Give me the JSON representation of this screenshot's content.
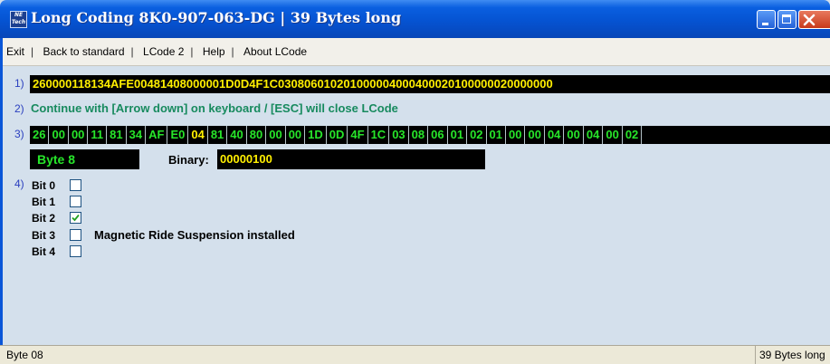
{
  "window": {
    "title": "Long Coding  8K0-907-063-DG | 39 Bytes long",
    "icon": "nf-tech-app-icon"
  },
  "menu": {
    "items": [
      "Exit",
      "Back to standard",
      "LCode 2",
      "Help",
      "About LCode"
    ],
    "separator": "|"
  },
  "rows": {
    "row1_num": "1)",
    "row2_num": "2)",
    "row3_num": "3)",
    "row4_num": "4)"
  },
  "coding_string": "260000118134AFE00481408000001D0D4F1C030806010201000004000400020100000020000000",
  "hint": "Continue with [Arrow down] on keyboard / [ESC] will close LCode",
  "bytes": [
    "26",
    "00",
    "00",
    "11",
    "81",
    "34",
    "AF",
    "E0",
    "04",
    "81",
    "40",
    "80",
    "00",
    "00",
    "1D",
    "0D",
    "4F",
    "1C",
    "03",
    "08",
    "06",
    "01",
    "02",
    "01",
    "00",
    "00",
    "04",
    "00",
    "04",
    "00",
    "02"
  ],
  "selected_byte_index": 8,
  "byte_label": "Byte 8",
  "binary_label": "Binary:",
  "binary_value": "00000100",
  "bits": [
    {
      "label": "Bit 0",
      "checked": false,
      "description": ""
    },
    {
      "label": "Bit 1",
      "checked": false,
      "description": ""
    },
    {
      "label": "Bit 2",
      "checked": true,
      "description": ""
    },
    {
      "label": "Bit 3",
      "checked": false,
      "description": "Magnetic Ride Suspension installed"
    },
    {
      "label": "Bit 4",
      "checked": false,
      "description": ""
    }
  ],
  "status": {
    "left": "Byte 08",
    "right": "39 Bytes long"
  },
  "colors": {
    "title_bar": "#0553d2",
    "byte_green": "#27e62a",
    "byte_selected": "#fff000",
    "hint_green": "#178a5e"
  }
}
